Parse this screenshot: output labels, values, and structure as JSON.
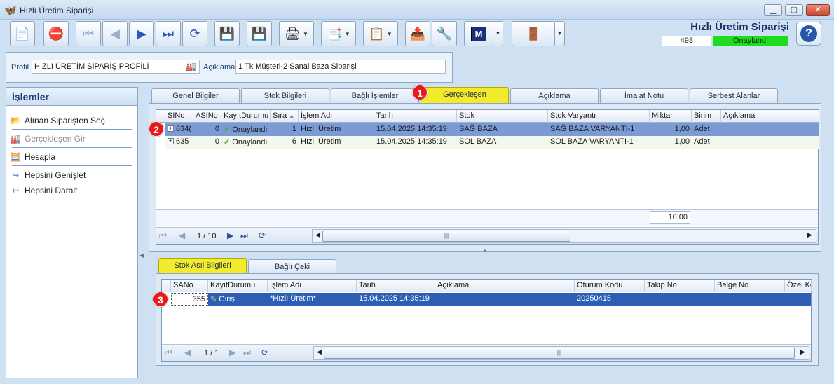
{
  "window": {
    "title": "Hızlı Üretim Siparişi"
  },
  "header": {
    "title": "Hızlı Üretim Siparişi",
    "number": "493",
    "status": "Onaylandı",
    "status_color": "#1fdc1f"
  },
  "toolbar": {
    "buttons": [
      {
        "name": "new-document-icon",
        "glyph": "📄"
      },
      {
        "name": "delete-document-icon",
        "glyph": "⛔"
      },
      {
        "name": "first-record-icon",
        "glyph": "⏮"
      },
      {
        "name": "previous-record-icon",
        "glyph": "◀"
      },
      {
        "name": "next-record-icon",
        "glyph": "▶"
      },
      {
        "name": "last-record-icon",
        "glyph": "⏭"
      },
      {
        "name": "refresh-icon",
        "glyph": "⟳"
      },
      {
        "name": "save-icon",
        "glyph": "💾"
      },
      {
        "name": "save-close-icon",
        "glyph": "💾"
      },
      {
        "name": "print-icon",
        "glyph": "🖨"
      },
      {
        "name": "pdf-export-icon",
        "glyph": "📑"
      },
      {
        "name": "transfer-icon",
        "glyph": "📋"
      },
      {
        "name": "import-icon",
        "glyph": "📥"
      },
      {
        "name": "tools-icon",
        "glyph": "🔧"
      },
      {
        "name": "m-module-icon",
        "glyph": "M"
      },
      {
        "name": "exit-icon",
        "glyph": "🚪"
      }
    ]
  },
  "profile": {
    "label": "Profil",
    "value": "HIZLI ÜRETİM SİPARİŞ PROFİLİ",
    "desc_label": "Açıklama",
    "desc_value": "1 Tk Müşteri-2 Sanal Baza Siparişi"
  },
  "sidebar": {
    "title": "İşlemler",
    "items": [
      {
        "label": "Alınan Siparişten Seç",
        "icon": "folder-icon",
        "glyph": "📂"
      },
      {
        "label": "Gerçekleşen Gir",
        "icon": "factory-icon",
        "glyph": "🏭"
      },
      {
        "label": "Hesapla",
        "icon": "calculator-icon",
        "glyph": "🧮"
      },
      {
        "label": "Hepsini Genişlet",
        "icon": "expand-icon",
        "glyph": "↪"
      },
      {
        "label": "Hepsini Daralt",
        "icon": "collapse-icon",
        "glyph": "↩"
      }
    ]
  },
  "tabs": [
    "Genel Bilgiler",
    "Stok Bilgileri",
    "Bağlı İşlemler",
    "Gerçekleşen",
    "Açıklama",
    "İmalat Notu",
    "Serbest Alanlar"
  ],
  "grid1": {
    "columns": [
      "SINo",
      "ASINo",
      "KayıtDurumu",
      "Sıra",
      "İşlem Adı",
      "Tarih",
      "Stok",
      "Stok Varyantı",
      "Miktar",
      "Birim",
      "Açıklama"
    ],
    "rows": [
      {
        "sino": "634(",
        "asino": "0",
        "durum": "Onaylandı",
        "sira": "1",
        "islem": "Hızlı Üretim",
        "tarih": "15.04.2025 14:35:19",
        "stok": "SAĞ BAZA",
        "varyant": "SAĞ BAZA VARYANTI-1",
        "miktar": "1,00",
        "birim": "Adet",
        "aciklama": ""
      },
      {
        "sino": "635",
        "asino": "0",
        "durum": "Onaylandı",
        "sira": "6",
        "islem": "Hızlı Üretim",
        "tarih": "15.04.2025 14:35:19",
        "stok": "SOL BAZA",
        "varyant": "SOL BAZA VARYANTI-1",
        "miktar": "1,00",
        "birim": "Adet",
        "aciklama": ""
      }
    ],
    "total": "10,00",
    "page": "1 / 10"
  },
  "subtabs": [
    "Stok Asıl Bilgileri",
    "Bağlı Çeki"
  ],
  "grid2": {
    "columns": [
      "SANo",
      "KayıtDurumu",
      "İşlem Adı",
      "Tarih",
      "Açıklama",
      "Oturum Kodu",
      "Takip No",
      "Belge No",
      "Özel Ko"
    ],
    "rows": [
      {
        "sano": "355",
        "durum": "Giriş",
        "islem": "*Hızlı Üretim*",
        "tarih": "15.04.2025 14:35:19",
        "aciklama": "",
        "oturum": "20250415",
        "takip": "",
        "belge": "",
        "ozel": ""
      }
    ],
    "page": "1 / 1"
  },
  "badges": [
    "1",
    "2",
    "3"
  ]
}
